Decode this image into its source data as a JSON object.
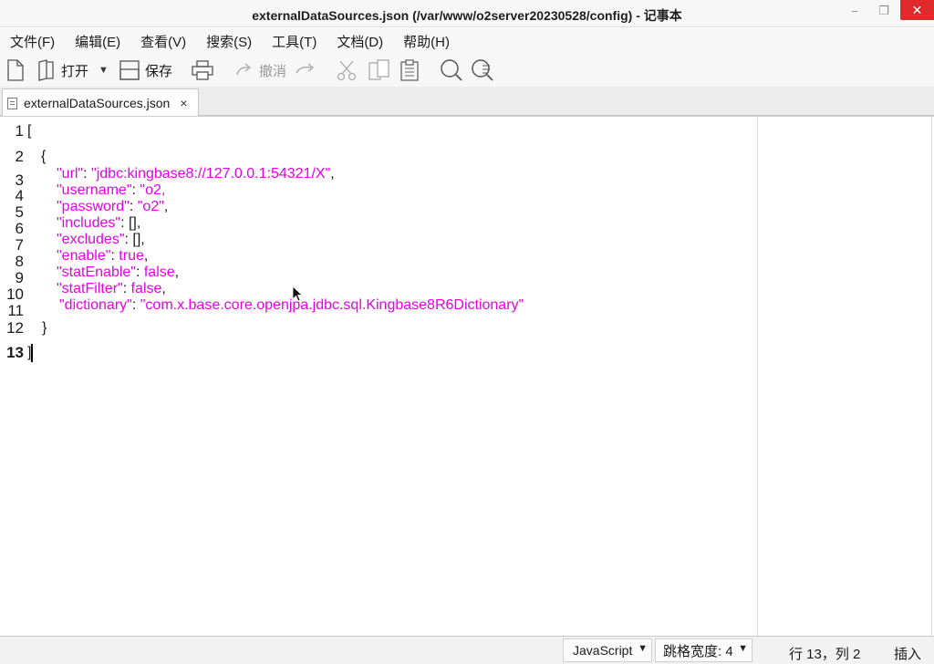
{
  "window": {
    "title": "externalDataSources.json (/var/www/o2server20230528/config) - 记事本",
    "minimize_glyph": "−",
    "maximize_glyph": "❐",
    "close_glyph": "✕"
  },
  "menu": [
    "文件(F)",
    "编辑(E)",
    "查看(V)",
    "搜索(S)",
    "工具(T)",
    "文档(D)",
    "帮助(H)"
  ],
  "toolbar": {
    "open_label": "打开",
    "save_label": "保存",
    "undo_label": "撤消",
    "icons": [
      "new-file-icon",
      "open-file-icon",
      "save-icon",
      "print-icon",
      "undo-icon",
      "redo-icon",
      "cut-icon",
      "copy-icon",
      "paste-icon",
      "find-icon",
      "replace-icon"
    ]
  },
  "tab": {
    "label": "externalDataSources.json",
    "close_glyph": "×"
  },
  "editor": {
    "current_line": 13,
    "line_numbers": [
      "1",
      "2",
      "3",
      "4",
      "5",
      "6",
      "7",
      "8",
      "9",
      "10",
      "11",
      "12",
      "13"
    ],
    "lines": {
      "l1": "[",
      "l2": "{",
      "url_key": "\"url\"",
      "url_val": "\"jdbc:kingbase8://127.0.0.1:54321/X\"",
      "username_key": "\"username\"",
      "username_val": "\"o2,",
      "password_key": "\"password\"",
      "password_val": "\"o2\"",
      "includes_key": "\"includes\"",
      "includes_val": "[],",
      "excludes_key": "\"excludes\"",
      "excludes_val": "[],",
      "enable_key": "\"enable\"",
      "enable_val": "true",
      "statEnable_key": "\"statEnable\"",
      "statEnable_val": "false",
      "statFilter_key": "\"statFilter\"",
      "statFilter_val": "false",
      "dictionary_key": "\"dictionary\"",
      "dictionary_val": "\"com.x.base.core.openjpa.jdbc.sql.Kingbase8R6Dictionary\"",
      "l12": "}",
      "l13": "]"
    }
  },
  "status": {
    "language": "JavaScript",
    "tab_width": "跳格宽度: 4",
    "position": "行 13，列 2",
    "mode": "插入"
  },
  "colors": {
    "json_key": "#e800e8",
    "json_value": "#e800e8",
    "punctuation": "#1a1a1a",
    "close_button": "#e0292b"
  }
}
